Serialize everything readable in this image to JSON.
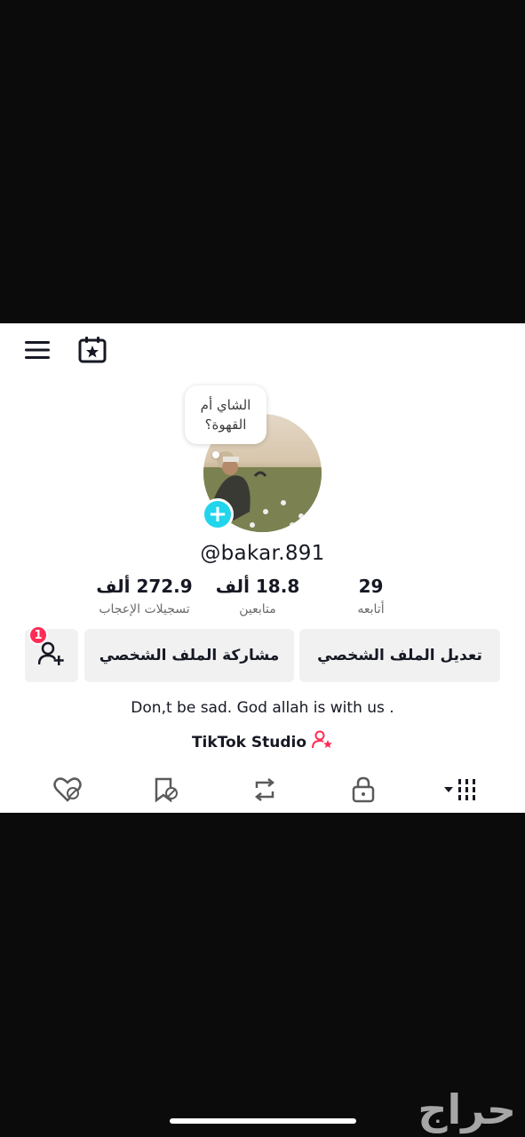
{
  "profile": {
    "bubble_text": "الشاي أم القهوة؟",
    "username": "@bakar.891",
    "bio": "Don,t be sad. God allah is with us .",
    "studio_label": "TikTok Studio"
  },
  "stats": [
    {
      "value": "29",
      "label": "أتابعه"
    },
    {
      "value": "18.8 ألف",
      "label": "متابعين"
    },
    {
      "value": "272.9 ألف",
      "label": "تسجيلات الإعجاب"
    }
  ],
  "actions": {
    "edit_label": "تعديل الملف الشخصي",
    "share_label": "مشاركة الملف الشخصي",
    "badge_count": "1"
  },
  "icons": {
    "menu": "menu-icon",
    "calendar": "calendar-star-icon",
    "add_friend": "add-user-icon",
    "studio": "user-star-icon",
    "tabs": [
      "grid-dropdown-icon",
      "lock-icon",
      "repost-icon",
      "bookmark-hidden-icon",
      "liked-hidden-icon"
    ]
  },
  "watermark": "حراج",
  "colors": {
    "accent": "#20d5ec",
    "badge": "#fe2c55",
    "studio_icon": "#fe2c55"
  }
}
